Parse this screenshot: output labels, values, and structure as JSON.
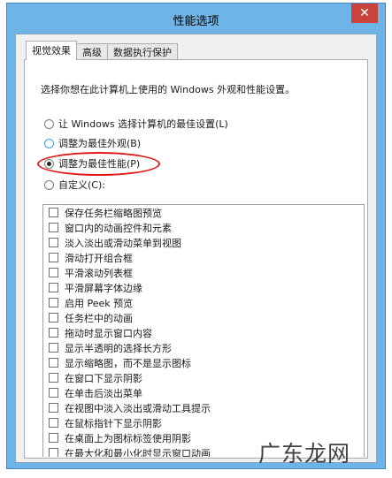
{
  "window": {
    "title": "性能选项",
    "close_icon": "close-icon"
  },
  "tabs": [
    {
      "label": "视觉效果",
      "active": true
    },
    {
      "label": "高级",
      "active": false
    },
    {
      "label": "数据执行保护",
      "active": false
    }
  ],
  "description": "选择你想在此计算机上使用的 Windows 外观和性能设置。",
  "radio_options": [
    {
      "label": "让 Windows 选择计算机的最佳设置(L)",
      "checked": false
    },
    {
      "label": "调整为最佳外观(B)",
      "checked": false
    },
    {
      "label": "调整为最佳性能(P)",
      "checked": true
    },
    {
      "label": "自定义(C):",
      "checked": false
    }
  ],
  "effects": [
    {
      "label": "保存任务栏缩略图预览",
      "checked": false
    },
    {
      "label": "窗口内的动画控件和元素",
      "checked": false
    },
    {
      "label": "淡入淡出或滑动菜单到视图",
      "checked": false
    },
    {
      "label": "滑动打开组合框",
      "checked": false
    },
    {
      "label": "平滑滚动列表框",
      "checked": false
    },
    {
      "label": "平滑屏幕字体边缘",
      "checked": false
    },
    {
      "label": "启用 Peek 预览",
      "checked": false
    },
    {
      "label": "任务栏中的动画",
      "checked": false
    },
    {
      "label": "拖动时显示窗口内容",
      "checked": false
    },
    {
      "label": "显示半透明的选择长方形",
      "checked": false
    },
    {
      "label": "显示缩略图，而不是显示图标",
      "checked": false
    },
    {
      "label": "在窗口下显示阴影",
      "checked": false
    },
    {
      "label": "在单击后淡出菜单",
      "checked": false
    },
    {
      "label": "在视图中淡入淡出或滑动工具提示",
      "checked": false
    },
    {
      "label": "在鼠标指针下显示阴影",
      "checked": false
    },
    {
      "label": "在桌面上为图标标签使用阴影",
      "checked": false
    },
    {
      "label": "在最大化和最小化时显示窗口动画",
      "checked": false
    }
  ],
  "watermark": "广东龙网",
  "colors": {
    "titlebar": "#6fb4e6",
    "close": "#c8433b",
    "highlight": "#e01b1b"
  }
}
